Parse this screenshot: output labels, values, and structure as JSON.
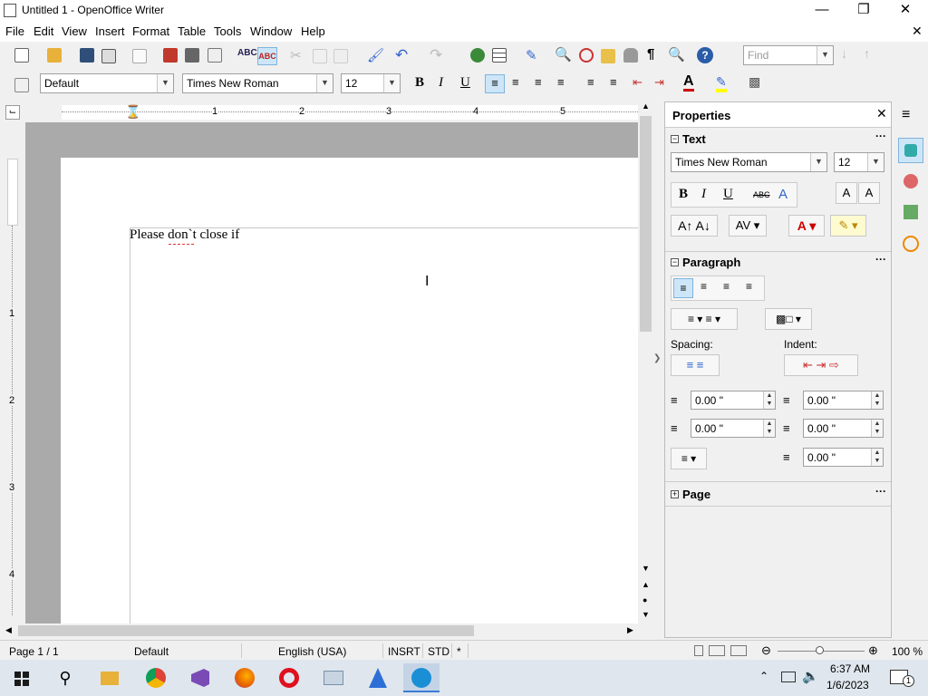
{
  "window": {
    "title": "Untitled 1 - OpenOffice Writer"
  },
  "menu": {
    "items": [
      "File",
      "Edit",
      "View",
      "Insert",
      "Format",
      "Table",
      "Tools",
      "Window",
      "Help"
    ]
  },
  "toolbar": {
    "find_placeholder": "Find"
  },
  "formatting": {
    "style": "Default",
    "font": "Times New Roman",
    "size": "12"
  },
  "ruler": {
    "marks": [
      "1",
      "2",
      "3",
      "4",
      "5"
    ],
    "vmarks": [
      "1",
      "2",
      "3",
      "4"
    ]
  },
  "document": {
    "text": "Please don`t close if"
  },
  "sidebar": {
    "title": "Properties",
    "text_section": {
      "title": "Text",
      "font": "Times New Roman",
      "size": "12"
    },
    "paragraph_section": {
      "title": "Paragraph",
      "spacing_label": "Spacing:",
      "indent_label": "Indent:",
      "above": "0.00 \"",
      "below": "0.00 \"",
      "before": "0.00 \"",
      "after": "0.00 \"",
      "first_line": "0.00 \""
    },
    "page_section": {
      "title": "Page"
    }
  },
  "status": {
    "page": "Page 1 / 1",
    "style": "Default",
    "language": "English (USA)",
    "insert_mode": "INSRT",
    "selection_mode": "STD",
    "modified": "*",
    "zoom": "100 %"
  },
  "taskbar": {
    "time": "6:37 AM",
    "date": "1/6/2023",
    "notification_count": "1"
  }
}
